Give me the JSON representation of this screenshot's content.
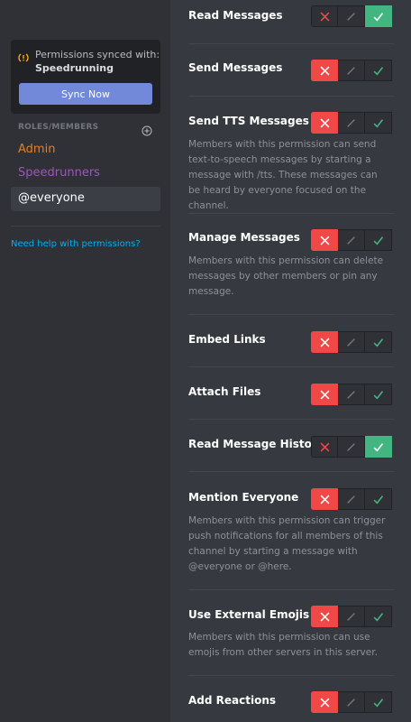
{
  "sidebar": {
    "sync_text": "Permissions synced with:",
    "sync_channel": "Speedrunning",
    "sync_button": "Sync Now",
    "roles_header": "ROLES/MEMBERS",
    "roles": [
      {
        "label": "Admin",
        "color": "#e67e22"
      },
      {
        "label": "Speedrunners",
        "color": "#9b59b6"
      },
      {
        "label": "@everyone",
        "color": "#ffffff",
        "selected": true
      }
    ],
    "help_link": "Need help with permissions?"
  },
  "permissions": [
    {
      "name": "Read Messages",
      "state": "allow",
      "description": ""
    },
    {
      "name": "Send Messages",
      "state": "deny",
      "description": ""
    },
    {
      "name": "Send TTS Messages",
      "state": "deny",
      "description": "Members with this permission can send text-to-speech messages by starting a message with /tts. These messages can be heard by everyone focused on the channel."
    },
    {
      "name": "Manage Messages",
      "state": "deny",
      "description": "Members with this permission can delete messages by other members or pin any message."
    },
    {
      "name": "Embed Links",
      "state": "deny",
      "description": ""
    },
    {
      "name": "Attach Files",
      "state": "deny",
      "description": ""
    },
    {
      "name": "Read Message History",
      "state": "allow",
      "description": ""
    },
    {
      "name": "Mention Everyone",
      "state": "deny",
      "description": "Members with this permission can trigger push notifications for all members of this channel by starting a message with @everyone or @here."
    },
    {
      "name": "Use External Emojis",
      "state": "deny",
      "description": "Members with this permission can use emojis from other servers in this server."
    },
    {
      "name": "Add Reactions",
      "state": "deny",
      "description": ""
    }
  ],
  "colors": {
    "deny": "#f04747",
    "allow": "#43b581",
    "accent": "#7289da",
    "link": "#00b0f4"
  }
}
